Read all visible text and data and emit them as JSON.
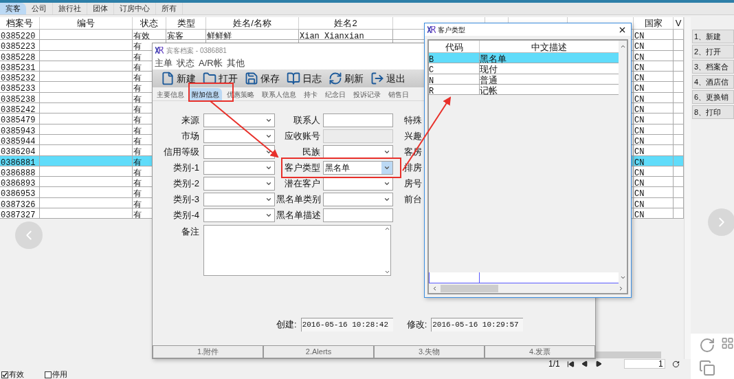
{
  "tabs": [
    {
      "label": "宾客",
      "selected": true
    },
    {
      "label": "公司",
      "selected": false
    },
    {
      "label": "旅行社",
      "selected": false
    },
    {
      "label": "团体",
      "selected": false
    },
    {
      "label": "订房中心",
      "selected": false
    },
    {
      "label": "所有",
      "selected": false
    }
  ],
  "table": {
    "columns": [
      {
        "label": "档案号"
      },
      {
        "label": "编号"
      },
      {
        "label": "状态"
      },
      {
        "label": "类型"
      },
      {
        "label": "姓名/名称"
      },
      {
        "label": "姓名2"
      },
      {
        "label": "国家"
      },
      {
        "label": "V"
      }
    ],
    "rows": [
      {
        "id": "0385220",
        "status": "有效",
        "type": "宾客",
        "name": "鲜鲜鲜",
        "name2": "Xian Xianxian",
        "country": "CN",
        "selected": false
      },
      {
        "id": "0385223",
        "status": "有",
        "country": "CN",
        "selected": false
      },
      {
        "id": "0385228",
        "status": "有",
        "country": "CN",
        "selected": false
      },
      {
        "id": "0385231",
        "status": "有",
        "country": "CN",
        "selected": false
      },
      {
        "id": "0385232",
        "status": "有",
        "country": "CN",
        "selected": false
      },
      {
        "id": "0385233",
        "status": "有",
        "country": "CN",
        "selected": false
      },
      {
        "id": "0385238",
        "status": "有",
        "country": "CN",
        "selected": false
      },
      {
        "id": "0385242",
        "status": "有",
        "country": "CN",
        "selected": false
      },
      {
        "id": "0385479",
        "status": "有",
        "country": "CN",
        "selected": false
      },
      {
        "id": "0385943",
        "status": "有",
        "country": "CN",
        "selected": false
      },
      {
        "id": "0385944",
        "status": "有",
        "country": "CN",
        "selected": false
      },
      {
        "id": "0386204",
        "status": "有",
        "country": "CN",
        "selected": false
      },
      {
        "id": "0386881",
        "status": "有",
        "country": "CN",
        "selected": true
      },
      {
        "id": "0386888",
        "status": "有",
        "country": "CN",
        "selected": false
      },
      {
        "id": "0386893",
        "status": "有",
        "country": "CN",
        "selected": false
      },
      {
        "id": "0386953",
        "status": "有",
        "country": "CN",
        "selected": false
      },
      {
        "id": "0387326",
        "status": "有",
        "country": "CN",
        "selected": false
      },
      {
        "id": "0387327",
        "status": "有",
        "country": "CN",
        "selected": false
      }
    ]
  },
  "side_buttons": [
    "1、新建",
    "2、打开",
    "3、档案合",
    "4、酒店信",
    "6、更换销",
    "8、打印"
  ],
  "pager": {
    "text": "1/1",
    "page": "1"
  },
  "footer": [
    {
      "label": "有效",
      "checked": true
    },
    {
      "label": "停用",
      "checked": false
    }
  ],
  "dialog": {
    "title": "宾客档案 - 0386881",
    "menu": [
      "主单",
      "状态",
      "A/R帐",
      "其他"
    ],
    "toolbar": [
      {
        "label": "新建",
        "kind": "new"
      },
      {
        "label": "打开",
        "kind": "open"
      },
      {
        "label": "保存",
        "kind": "save"
      },
      {
        "label": "日志",
        "kind": "log"
      },
      {
        "label": "刷新",
        "kind": "refresh"
      },
      {
        "label": "退出",
        "kind": "exit"
      }
    ],
    "tabs": [
      {
        "label": "主要信息",
        "selected": false
      },
      {
        "label": "附加信息",
        "selected": true
      },
      {
        "label": "优惠策略",
        "selected": false
      },
      {
        "label": "联系人信息",
        "selected": false
      },
      {
        "label": "持卡",
        "selected": false
      },
      {
        "label": "纪念日",
        "selected": false
      },
      {
        "label": "投诉记录",
        "selected": false
      },
      {
        "label": "销售日",
        "selected": false
      }
    ],
    "rows": [
      {
        "left": {
          "label": "来源"
        },
        "mid": {
          "label": "联系人",
          "kind": "text",
          "disabled": false
        },
        "right": "特殊"
      },
      {
        "left": {
          "label": "市场"
        },
        "mid": {
          "label": "应收账号",
          "kind": "text",
          "disabled": true
        },
        "right": "兴趣"
      },
      {
        "left": {
          "label": "信用等级"
        },
        "mid": {
          "label": "民族",
          "kind": "dropdown"
        },
        "right": "客房"
      },
      {
        "left": {
          "label": "类别-1"
        },
        "mid": {
          "label": "客户类型",
          "kind": "dropdown",
          "value": "黑名单",
          "focused": true
        },
        "right": "排房"
      },
      {
        "left": {
          "label": "类别-2"
        },
        "mid": {
          "label": "潜在客户",
          "kind": "dropdown"
        },
        "right": "房号"
      },
      {
        "left": {
          "label": "类别-3"
        },
        "mid": {
          "label": "黑名单类别",
          "kind": "dropdown"
        },
        "right": "前台"
      },
      {
        "left": {
          "label": "类别-4"
        },
        "mid": {
          "label": "黑名单描述",
          "kind": "text",
          "disabled": false
        }
      }
    ],
    "remarks_label": "备注",
    "created_label": "创建:",
    "created": "2016-05-16 10:28:42",
    "modified_label": "修改:",
    "modified": "2016-05-16 10:29:57",
    "bottom_buttons": [
      "1.附件",
      "2.Alerts",
      "3.失物",
      "4.发票"
    ]
  },
  "popup": {
    "title": "客户类型",
    "columns": [
      "代码",
      "中文描述"
    ],
    "rows": [
      {
        "code": "B",
        "desc": "黑名单",
        "selected": true
      },
      {
        "code": "C",
        "desc": "现付",
        "selected": false
      },
      {
        "code": "N",
        "desc": "普通",
        "selected": false
      },
      {
        "code": "R",
        "desc": "记帐",
        "selected": false
      }
    ]
  }
}
